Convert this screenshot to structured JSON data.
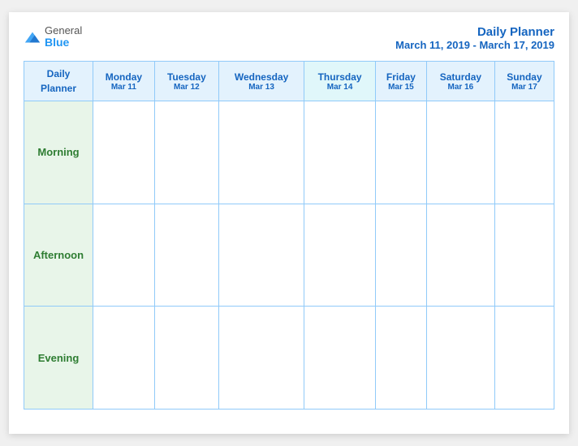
{
  "logo": {
    "general": "General",
    "blue": "Blue",
    "icon_color": "#2196F3"
  },
  "title": {
    "main": "Daily Planner",
    "sub": "March 11, 2019 - March 17, 2019"
  },
  "header_col": {
    "label": "Daily\nPlanner"
  },
  "days": [
    {
      "name": "Monday",
      "date": "Mar 11"
    },
    {
      "name": "Tuesday",
      "date": "Mar 12"
    },
    {
      "name": "Wednesday",
      "date": "Mar 13"
    },
    {
      "name": "Thursday",
      "date": "Mar 14",
      "highlight": true
    },
    {
      "name": "Friday",
      "date": "Mar 15"
    },
    {
      "name": "Saturday",
      "date": "Mar 16"
    },
    {
      "name": "Sunday",
      "date": "Mar 17"
    }
  ],
  "rows": [
    {
      "label": "Morning"
    },
    {
      "label": "Afternoon"
    },
    {
      "label": "Evening"
    }
  ]
}
